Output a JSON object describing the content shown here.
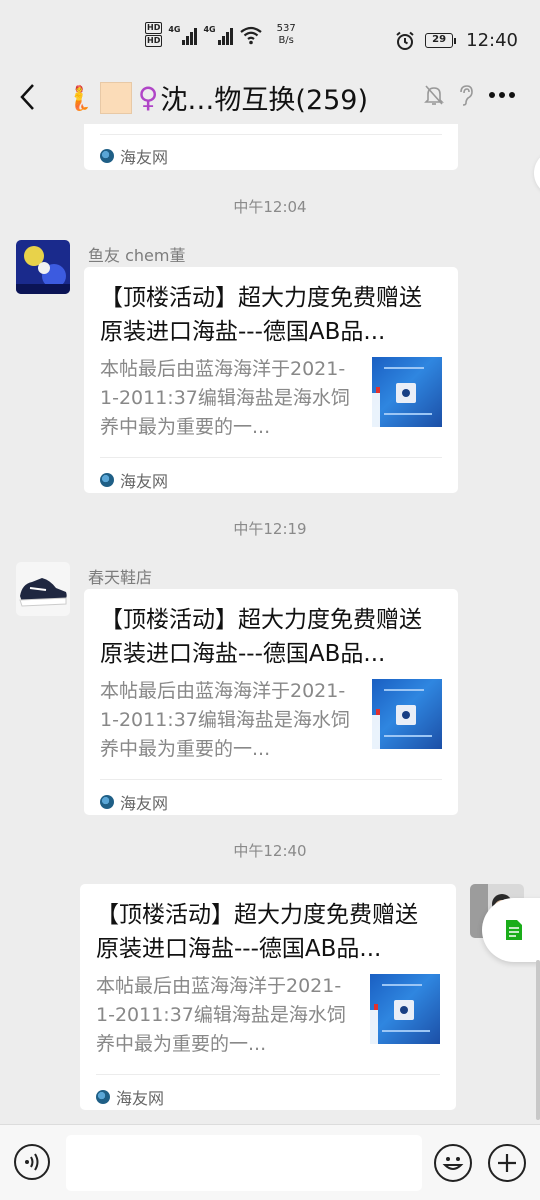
{
  "status_bar": {
    "network_1": "4G",
    "network_2": "4G",
    "hd_1": "HD",
    "hd_2": "HD",
    "speed_value": "537",
    "speed_unit": "B/s",
    "battery": "29",
    "time": "12:40"
  },
  "header": {
    "title_text": "沈…物互换(259)",
    "icons": [
      "back-icon",
      "mute-bell-icon",
      "ear-icon",
      "more-icon"
    ]
  },
  "messages": [
    {
      "type": "card-partial",
      "source": "海友网"
    },
    {
      "type": "timestamp",
      "text": "中午12:04"
    },
    {
      "type": "card",
      "sender": "鱼友 chem董",
      "title": "【顶楼活动】超大力度免费赠送原装进口海盐---德国AB品...",
      "desc": "本帖最后由蓝海海洋于2021-1-2011:37编辑海盐是海水饲养中最为重要的一...",
      "source": "海友网"
    },
    {
      "type": "timestamp",
      "text": "中午12:19"
    },
    {
      "type": "card",
      "sender": "春天鞋店",
      "title": "【顶楼活动】超大力度免费赠送原装进口海盐---德国AB品...",
      "desc": "本帖最后由蓝海海洋于2021-1-2011:37编辑海盐是海水饲养中最为重要的一...",
      "source": "海友网"
    },
    {
      "type": "timestamp",
      "text": "中午12:40"
    },
    {
      "type": "card-self",
      "title": "【顶楼活动】超大力度免费赠送原装进口海盐---德国AB品...",
      "desc": "本帖最后由蓝海海洋于2021-1-2011:37编辑海盐是海水饲养中最为重要的一...",
      "source": "海友网"
    }
  ],
  "input_bar": {
    "icons": [
      "voice-icon",
      "emoji-icon",
      "plus-icon"
    ]
  },
  "colors": {
    "background": "#ededed",
    "card": "#ffffff",
    "timestamp": "#8a8a8a",
    "float_doc": "#1aad19"
  }
}
